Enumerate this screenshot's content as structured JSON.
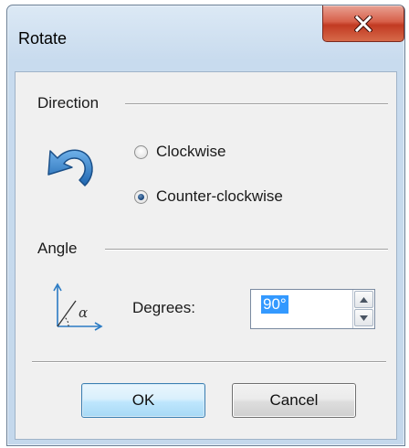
{
  "window": {
    "title": "Rotate",
    "close_glyph": "x"
  },
  "direction": {
    "heading": "Direction",
    "icon": "rotate-counterclockwise-icon",
    "options": [
      {
        "label": "Clockwise",
        "selected": false
      },
      {
        "label": "Counter-clockwise",
        "selected": true
      }
    ]
  },
  "angle": {
    "heading": "Angle",
    "icon": "angle-icon",
    "icon_symbol": "α",
    "degrees_label": "Degrees:",
    "degrees_value": "90°"
  },
  "buttons": {
    "ok_label": "OK",
    "cancel_label": "Cancel"
  },
  "colors": {
    "selection": "#3399ff",
    "close_button": "#c23a22",
    "icon_blue": "#2a7bc4"
  }
}
